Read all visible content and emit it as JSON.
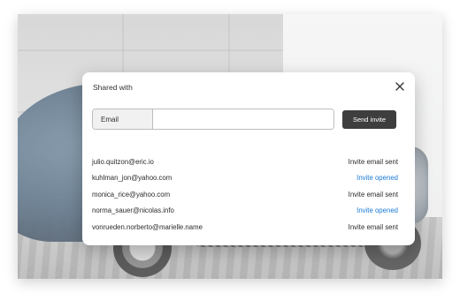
{
  "modal": {
    "title": "Shared with",
    "close_icon": "close-icon",
    "email_label": "Email",
    "email_value": "",
    "email_placeholder": "",
    "send_button_label": "Send invite"
  },
  "shares": [
    {
      "email": "julio.quitzon@eric.io",
      "status": "Invite email sent",
      "state": "sent"
    },
    {
      "email": "kuhlman_jon@yahoo.com",
      "status": "Invite opened",
      "state": "opened"
    },
    {
      "email": "monica_rice@yahoo.com",
      "status": "Invite email sent",
      "state": "sent"
    },
    {
      "email": "norma_sauer@nicolas.info",
      "status": "Invite opened",
      "state": "opened"
    },
    {
      "email": "vonrueden.norberto@marielle.name",
      "status": "Invite email sent",
      "state": "sent"
    }
  ],
  "colors": {
    "opened_status": "#1a7bd6",
    "sent_status": "#2b2b2b",
    "button_bg": "#3e3e3e"
  }
}
